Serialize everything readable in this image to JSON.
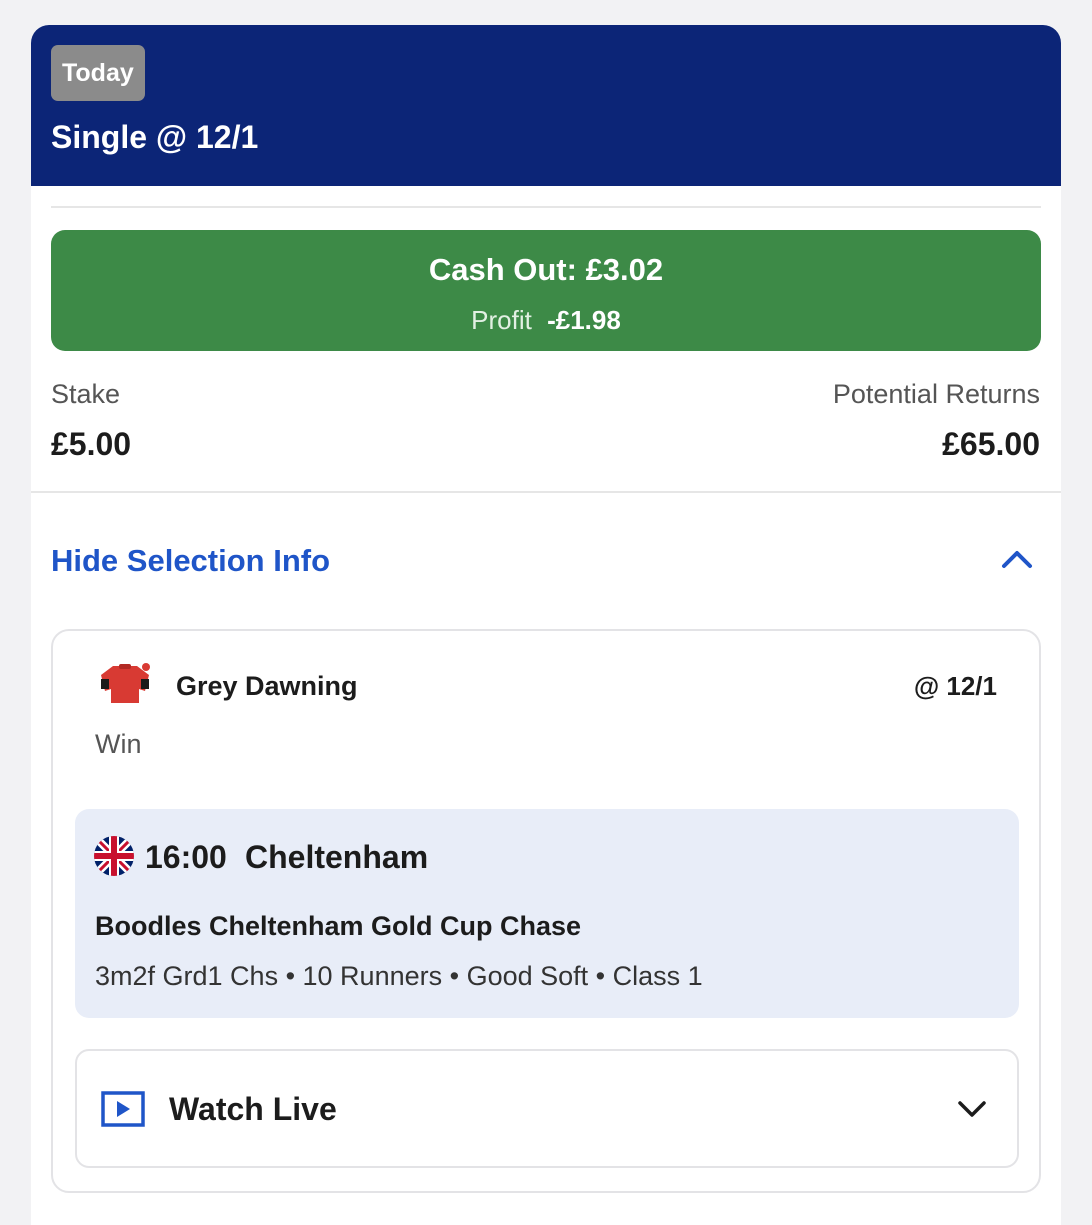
{
  "header": {
    "badge": "Today",
    "bet_title": "Single @ 12/1",
    "background_color": "#0c2577"
  },
  "cashout": {
    "label": "Cash Out: £3.02",
    "profit_label": "Profit",
    "profit_value": "-£1.98",
    "color": "#3d8a47"
  },
  "stake": {
    "label": "Stake",
    "value": "£5.00"
  },
  "returns": {
    "label": "Potential Returns",
    "value": "£65.00"
  },
  "selection_toggle": {
    "label": "Hide Selection Info",
    "icon": "chevron-up-icon",
    "color": "#1f55c8"
  },
  "selection": {
    "silks_icon": "jockey-silks-icon",
    "horse": "Grey Dawning",
    "odds": "@ 12/1",
    "market": "Win"
  },
  "race": {
    "flag_icon": "uk-flag-icon",
    "time": "16:00",
    "course": "Cheltenham",
    "name": "Boodles Cheltenham Gold Cup Chase",
    "details": "3m2f Grd1 Chs • 10 Runners • Good Soft • Class 1"
  },
  "watch_live": {
    "icon": "play-icon",
    "label": "Watch Live",
    "chevron_icon": "chevron-down-icon"
  }
}
